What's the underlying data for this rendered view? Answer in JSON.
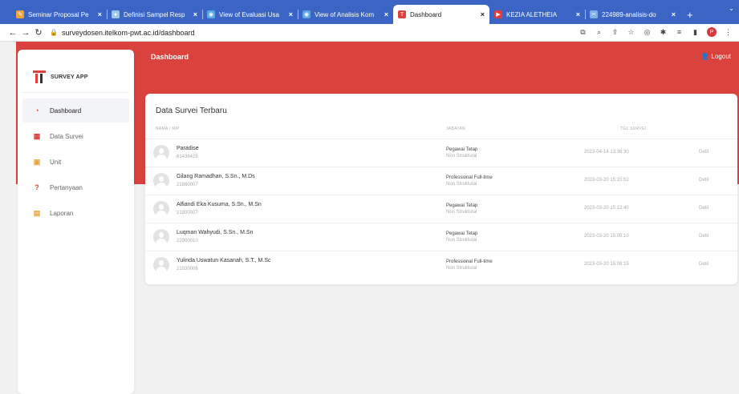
{
  "browser": {
    "tabs": [
      {
        "title": "Seminar Proposal Pe",
        "color": "#f2a33a",
        "glyph": "✎",
        "active": false
      },
      {
        "title": "Definisi Sampel Resp",
        "color": "#9dc6e8",
        "glyph": "●",
        "active": false
      },
      {
        "title": "View of Evaluasi Usa",
        "color": "#5aa7e8",
        "glyph": "◉",
        "active": false
      },
      {
        "title": "View of Analisis Kom",
        "color": "#5aa7e8",
        "glyph": "◉",
        "active": false
      },
      {
        "title": "Dashboard",
        "color": "#d9423d",
        "glyph": "T",
        "active": true
      },
      {
        "title": "KEZIA ALETHEIA",
        "color": "#e23b3b",
        "glyph": "▶",
        "active": false
      },
      {
        "title": "224989-analisis-do",
        "color": "#7fb0e8",
        "glyph": "✂",
        "active": false
      }
    ],
    "url": "surveydosen.itelkom-pwt.ac.id/dashboard"
  },
  "app": {
    "brand": "SURVEY APP",
    "page_title": "Dashboard",
    "logout_label": "Logout",
    "menu": [
      {
        "label": "Dashboard",
        "icon": "dashboard-icon",
        "color": "#d9423d",
        "active": true
      },
      {
        "label": "Data Survei",
        "icon": "table-icon",
        "color": "#d9423d",
        "active": false
      },
      {
        "label": "Unit",
        "icon": "grid-icon",
        "color": "#e8a23a",
        "active": false
      },
      {
        "label": "Pertanyaan",
        "icon": "question-icon",
        "color": "#d9423d",
        "active": false
      },
      {
        "label": "Laporan",
        "icon": "document-icon",
        "color": "#e8a23a",
        "active": false
      }
    ]
  },
  "survey_table": {
    "title": "Data Survei Terbaru",
    "headers": {
      "name": "NAMA / NIP",
      "position": "JABATAN",
      "date": "TGL SURVEI"
    },
    "detail_label": "Detil",
    "rows": [
      {
        "name": "Paradise",
        "nip": "61436425",
        "position": "Pegawai Tetap",
        "position_sub": "Non Struktural",
        "date": "2023-04-14 13:38:30"
      },
      {
        "name": "Gilang Ramadhan, S.Sn., M.Ds",
        "nip": "21860007",
        "position": "Professional Full-time",
        "position_sub": "Non Struktural",
        "date": "2023-03-20 15:15:52"
      },
      {
        "name": "Alfiandi Eka Kusuma, S.Sn., M.Sn",
        "nip": "21900007",
        "position": "Pegawai Tetap",
        "position_sub": "Non Struktural",
        "date": "2023-03-20 15:12:40"
      },
      {
        "name": "Luqman Wahyudi, S.Sn., M.Sn",
        "nip": "22900010",
        "position": "Pegawai Tetap",
        "position_sub": "Non Struktural",
        "date": "2023-03-20 15:05:10"
      },
      {
        "name": "Yulinda Uswatun Kasanah, S.T., M.Sc",
        "nip": "21930006",
        "position": "Professional Full-time",
        "position_sub": "Non Struktural",
        "date": "2023-03-20 15:08:15"
      }
    ]
  }
}
